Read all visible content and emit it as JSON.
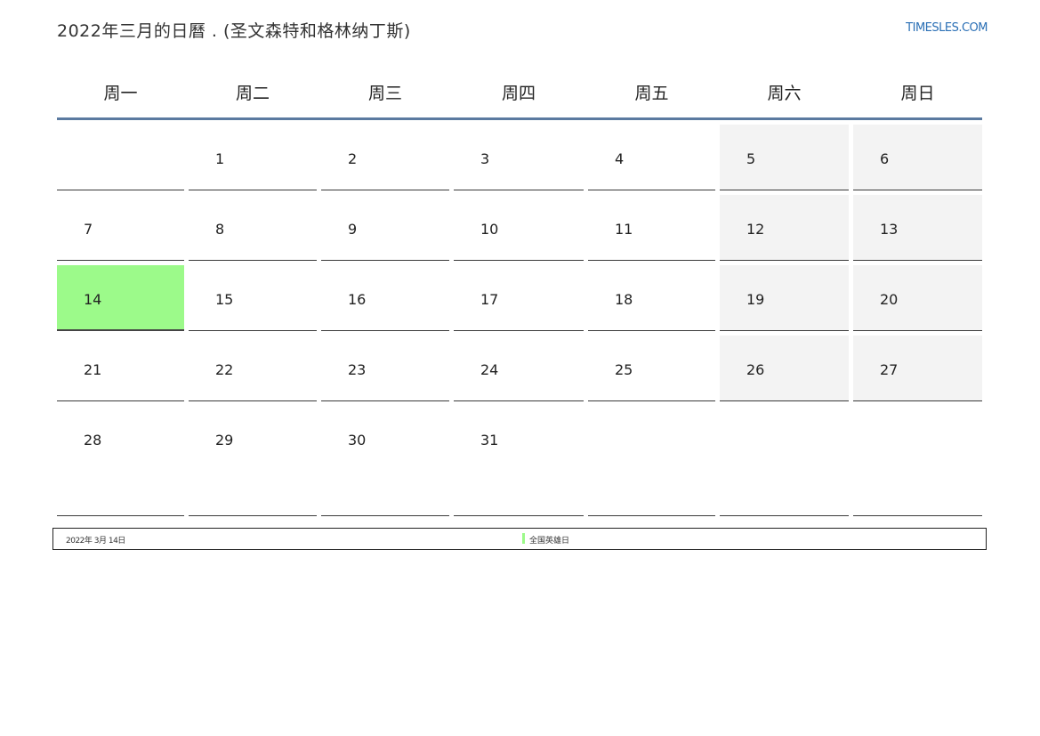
{
  "header": {
    "title": "2022年三月的日曆 . (圣文森特和格林纳丁斯)",
    "site": "TIMESLES.COM"
  },
  "weekdays": [
    "周一",
    "周二",
    "周三",
    "周四",
    "周五",
    "周六",
    "周日"
  ],
  "weeks": [
    [
      "",
      "1",
      "2",
      "3",
      "4",
      "5",
      "6"
    ],
    [
      "7",
      "8",
      "9",
      "10",
      "11",
      "12",
      "13"
    ],
    [
      "14",
      "15",
      "16",
      "17",
      "18",
      "19",
      "20"
    ],
    [
      "21",
      "22",
      "23",
      "24",
      "25",
      "26",
      "27"
    ],
    [
      "28",
      "29",
      "30",
      "31",
      "",
      "",
      ""
    ]
  ],
  "highlight": {
    "day": "14",
    "color": "#9cfa8a"
  },
  "colors": {
    "weekend_bg": "#f3f3f3",
    "header_rule": "#5b7aa0",
    "site_link": "#2a6fb5"
  },
  "footer": {
    "date": "2022年 3月 14日",
    "holiday_name": "全国英雄日"
  }
}
